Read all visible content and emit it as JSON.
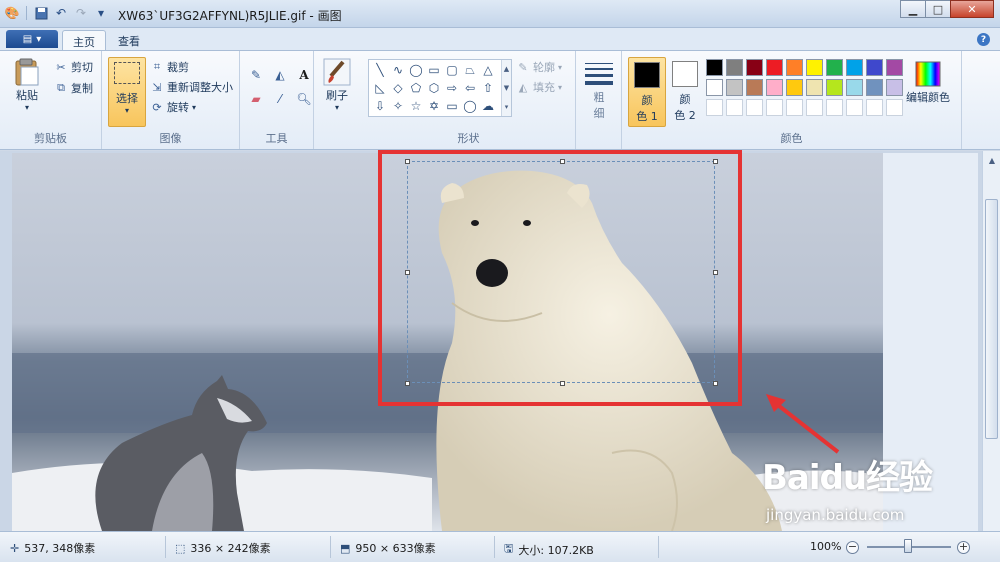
{
  "window": {
    "title": "XW63`UF3G2AFFYNL)R5JLIE.gif - 画图",
    "minimize_icon": "minimize-icon",
    "maximize_icon": "maximize-icon",
    "close_icon": "close-icon"
  },
  "tabs": [
    {
      "label": "主页",
      "active": true
    },
    {
      "label": "查看",
      "active": false
    }
  ],
  "ribbon": {
    "clipboard": {
      "label": "剪贴板",
      "paste": "粘贴",
      "cut": "剪切",
      "copy": "复制"
    },
    "image": {
      "label": "图像",
      "select": "选择",
      "crop": "裁剪",
      "resize": "重新调整大小",
      "rotate": "旋转"
    },
    "tools": {
      "label": "工具"
    },
    "brushes": {
      "label": "刷子"
    },
    "shapes": {
      "label": "形状",
      "outline": "轮廓",
      "fill": "填充"
    },
    "size": {
      "label_top": "粗",
      "label_bottom": "细"
    },
    "colors": {
      "label": "颜色",
      "color1_top": "颜",
      "color1_bottom": "色 1",
      "color2_top": "颜",
      "color2_bottom": "色 2",
      "edit_colors": "编辑颜色",
      "color1_value": "#000000",
      "color2_value": "#ffffff",
      "palette_row1": [
        "#000000",
        "#7f7f7f",
        "#880015",
        "#ed1c24",
        "#ff7f27",
        "#fff200",
        "#22b14c",
        "#00a2e8",
        "#3f48cc",
        "#a349a4"
      ],
      "palette_row2": [
        "#ffffff",
        "#c3c3c3",
        "#b97a57",
        "#ffaec9",
        "#ffc90e",
        "#efe4b0",
        "#b5e61d",
        "#99d9ea",
        "#7092be",
        "#c8bfe7"
      ]
    }
  },
  "status": {
    "cursor": "537, 348像素",
    "selection": "336 × 242像素",
    "image_size": "950 × 633像素",
    "file_size": "大小: 107.2KB",
    "zoom": "100%",
    "zoom_level": 0.5
  },
  "watermark": {
    "brand": "Baidu经验",
    "url": "jingyan.baidu.com"
  }
}
